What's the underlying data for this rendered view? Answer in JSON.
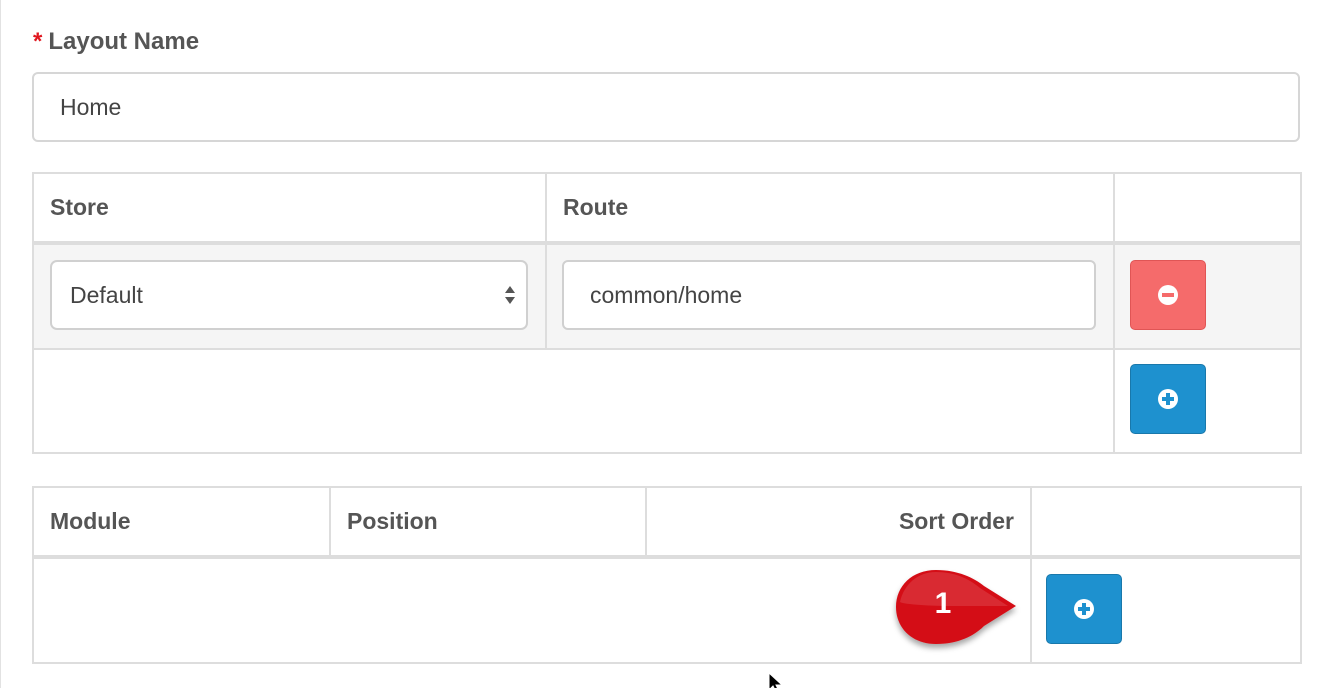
{
  "layout_name": {
    "required_marker": "*",
    "label": "Layout Name",
    "value": "Home"
  },
  "route_table": {
    "headers": {
      "store": "Store",
      "route": "Route"
    },
    "rows": [
      {
        "store": "Default",
        "route": "common/home"
      }
    ]
  },
  "module_table": {
    "headers": {
      "module": "Module",
      "position": "Position",
      "sort_order": "Sort Order"
    }
  },
  "callout": {
    "number": "1"
  },
  "icons": {
    "remove": "minus-circle-icon",
    "add": "plus-circle-icon",
    "select": "select-arrows-icon"
  },
  "colors": {
    "danger": "#f56b6b",
    "primary": "#1e91cf",
    "required": "#e0171f",
    "callout": "#d40f17"
  }
}
